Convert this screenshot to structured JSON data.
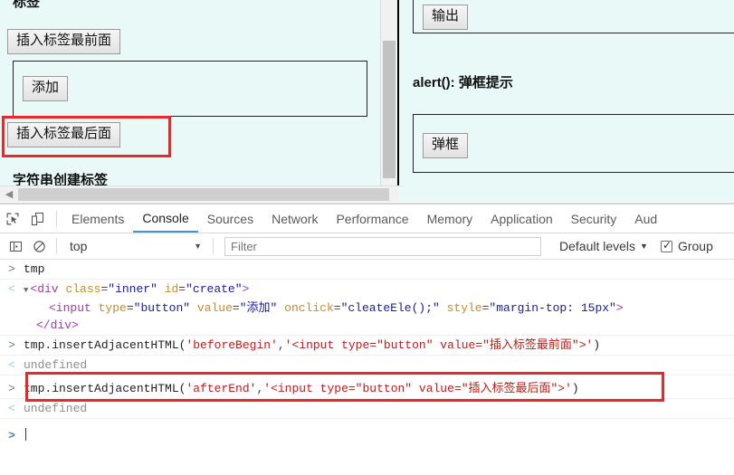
{
  "page": {
    "background_color": "#e9f9f8",
    "left_section": {
      "cut_heading": "标签",
      "button_before": "插入标签最前面",
      "inner_button": "添加",
      "button_after": "插入标签最后面",
      "next_heading": "字符串创建标签"
    },
    "right_section": {
      "button_output": "输出",
      "heading_alert": "alert(): 弹框提示",
      "button_alert": "弹框"
    },
    "annotations": [
      {
        "name": "highlight-insert-after-button",
        "color": "#e8282a"
      }
    ]
  },
  "devtools": {
    "toolbar_icons": [
      {
        "name": "inspect-element-icon",
        "label": "Inspect element"
      },
      {
        "name": "device-toolbar-icon",
        "label": "Toggle device toolbar"
      }
    ],
    "tabs": [
      {
        "label": "Elements",
        "active": false
      },
      {
        "label": "Console",
        "active": true
      },
      {
        "label": "Sources",
        "active": false
      },
      {
        "label": "Network",
        "active": false
      },
      {
        "label": "Performance",
        "active": false
      },
      {
        "label": "Memory",
        "active": false
      },
      {
        "label": "Application",
        "active": false
      },
      {
        "label": "Security",
        "active": false
      },
      {
        "label": "Aud",
        "active": false
      }
    ],
    "filter_bar": {
      "sidebar_toggle_icon": "sidebar-icon",
      "clear_console_icon": "clear-console-icon",
      "context_value": "top",
      "context_caret": "▼",
      "filter_placeholder": "Filter",
      "filter_value": "",
      "levels_label": "Default levels",
      "levels_caret": "▼",
      "group_similar_label": "Group",
      "group_similar_checked": true
    },
    "console": {
      "accent_color": "#4a90d9",
      "rows": [
        {
          "type": "input",
          "gutter": ">",
          "text": "tmp"
        },
        {
          "type": "output",
          "gutter": "<",
          "triangle": "▼",
          "line1_tag_open": "<div",
          "line1_attr1": "class",
          "line1_val1": "\"inner\"",
          "line1_attr2": "id",
          "line1_val2": "\"create\"",
          "line1_close": ">",
          "line2_tag": "<input",
          "line2_attr1": "type",
          "line2_val1": "\"button\"",
          "line2_attr2": "value",
          "line2_val2": "\"添加\"",
          "line2_attr3": "onclick",
          "line2_val3": "\"cleateEle();\"",
          "line2_attr4": "style",
          "line2_val4": "\"margin-top: 15px\"",
          "line2_close": ">",
          "line3": "</div>"
        },
        {
          "type": "input",
          "gutter": ">",
          "code_fn": "tmp.insertAdjacentHTML(",
          "code_arg1": "'beforeBegin'",
          "code_comma": ",",
          "code_arg2": "'<input type=\"button\" value=\"插入标签最前面\">'",
          "code_end": ")"
        },
        {
          "type": "output",
          "gutter": "<",
          "text": "undefined"
        },
        {
          "type": "input",
          "gutter": ">",
          "highlighted": true,
          "code_fn": "tmp.insertAdjacentHTML(",
          "code_arg1": "'afterEnd'",
          "code_comma": ",",
          "code_arg2": "'<input type=\"button\" value=\"插入标签最后面\">'",
          "code_end": ")"
        },
        {
          "type": "output",
          "gutter": "<",
          "text": "undefined"
        },
        {
          "type": "prompt",
          "gutter": ">",
          "text": ""
        }
      ]
    }
  }
}
